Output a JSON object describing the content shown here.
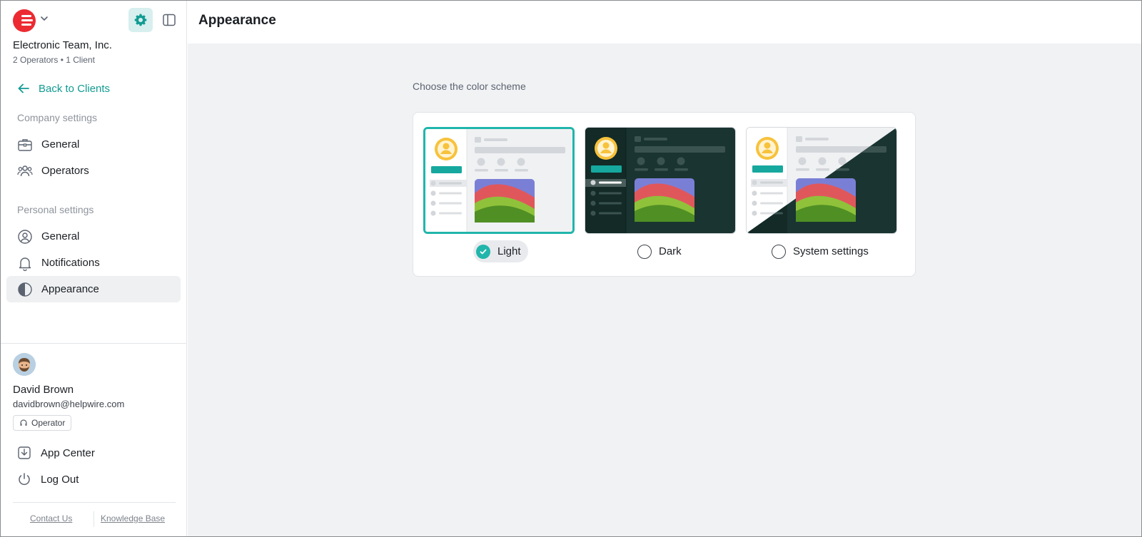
{
  "sidebar": {
    "org_name": "Electronic Team, Inc.",
    "org_meta": "2 Operators • 1 Client",
    "back_link": "Back to Clients",
    "company_section": "Company settings",
    "company_items": [
      "General",
      "Operators"
    ],
    "personal_section": "Personal settings",
    "personal_items": [
      "General",
      "Notifications",
      "Appearance"
    ],
    "active_item": "Appearance"
  },
  "user": {
    "name": "David Brown",
    "email": "davidbrown@helpwire.com",
    "role": "Operator"
  },
  "bottom_menu": {
    "app_center": "App Center",
    "log_out": "Log Out"
  },
  "footer": {
    "contact": "Contact Us",
    "kb": "Knowledge Base"
  },
  "header": {
    "title": "Appearance"
  },
  "appearance": {
    "prompt": "Choose the color scheme",
    "options": [
      "Light",
      "Dark",
      "System settings"
    ],
    "selected": "Light"
  },
  "colors": {
    "accent": "#21b5ab",
    "brand": "#ec2a32",
    "dark_theme": "#17302d"
  },
  "icons": {
    "logo": "helpwire-logo",
    "settings": "gear-icon",
    "panel": "sidebar-toggle-icon",
    "back": "arrow-left-icon"
  }
}
